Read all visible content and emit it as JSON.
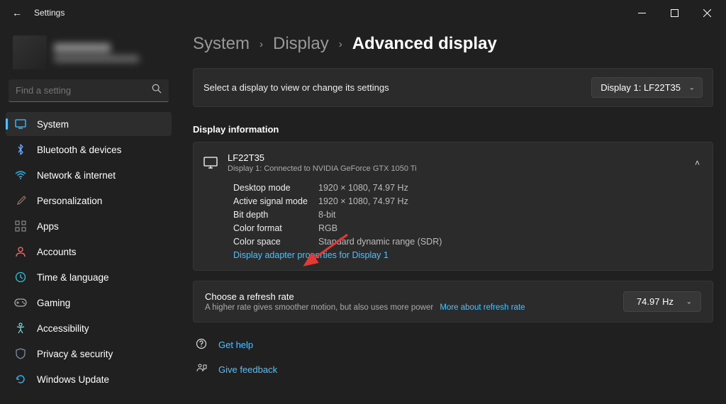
{
  "titlebar": {
    "title": "Settings"
  },
  "search": {
    "placeholder": "Find a setting"
  },
  "nav": [
    {
      "label": "System"
    },
    {
      "label": "Bluetooth & devices"
    },
    {
      "label": "Network & internet"
    },
    {
      "label": "Personalization"
    },
    {
      "label": "Apps"
    },
    {
      "label": "Accounts"
    },
    {
      "label": "Time & language"
    },
    {
      "label": "Gaming"
    },
    {
      "label": "Accessibility"
    },
    {
      "label": "Privacy & security"
    },
    {
      "label": "Windows Update"
    }
  ],
  "breadcrumb": {
    "system": "System",
    "display": "Display",
    "page": "Advanced display"
  },
  "toprow": {
    "text": "Select a display to view or change its settings",
    "selected": "Display 1: LF22T35"
  },
  "displayinfo": {
    "section_title": "Display information",
    "monitor": "LF22T35",
    "sub": "Display 1: Connected to NVIDIA GeForce GTX 1050 Ti",
    "rows": [
      {
        "k": "Desktop mode",
        "v": "1920 × 1080, 74.97 Hz"
      },
      {
        "k": "Active signal mode",
        "v": "1920 × 1080, 74.97 Hz"
      },
      {
        "k": "Bit depth",
        "v": "8-bit"
      },
      {
        "k": "Color format",
        "v": "RGB"
      },
      {
        "k": "Color space",
        "v": "Standard dynamic range (SDR)"
      }
    ],
    "adapter_link": "Display adapter properties for Display 1"
  },
  "refresh": {
    "title": "Choose a refresh rate",
    "sub": "A higher rate gives smoother motion, but also uses more power",
    "more": "More about refresh rate",
    "value": "74.97 Hz"
  },
  "help": {
    "get_help": "Get help",
    "feedback": "Give feedback"
  }
}
